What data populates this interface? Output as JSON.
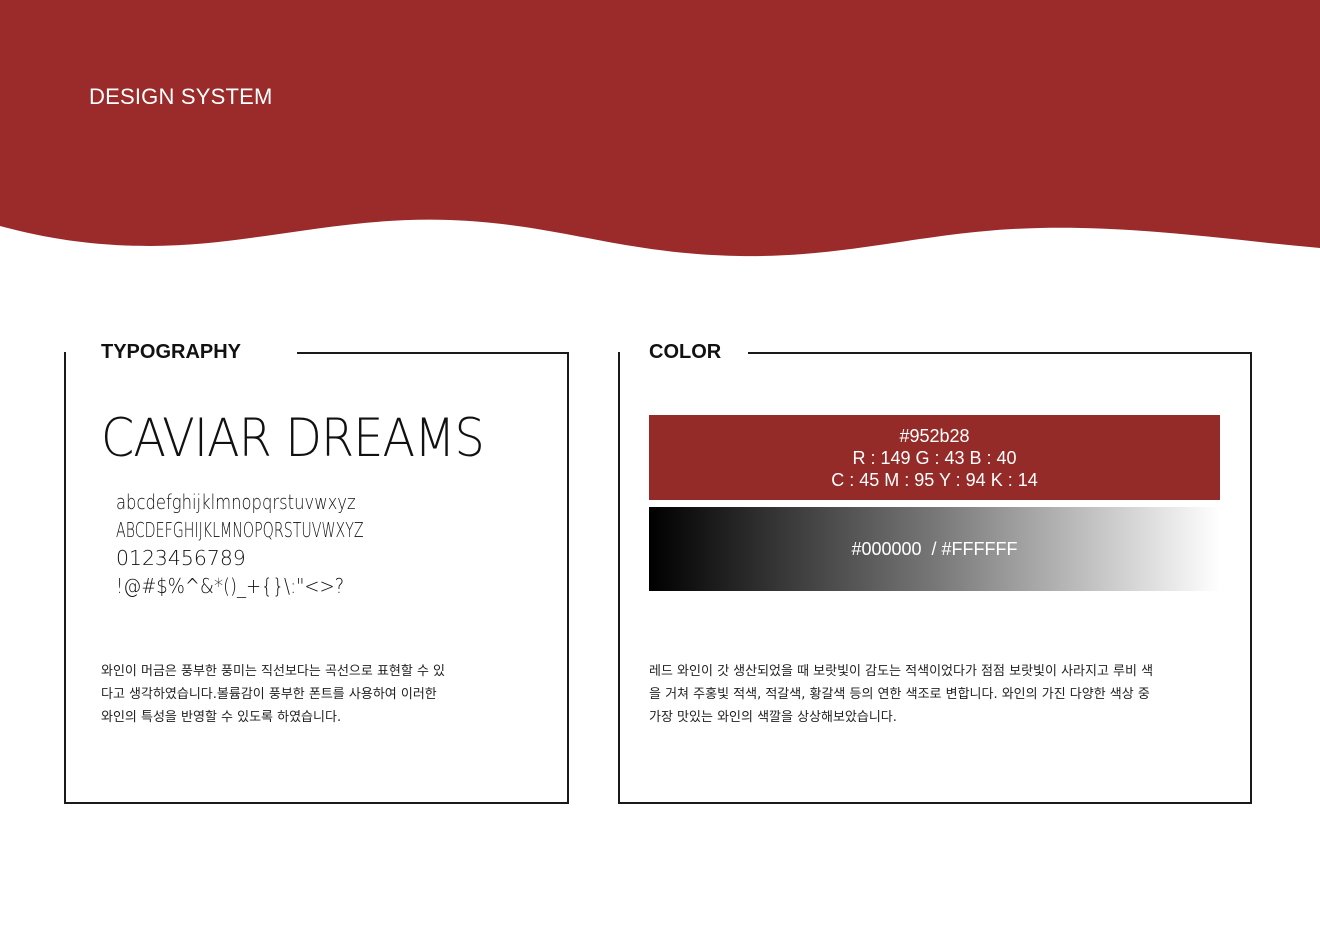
{
  "header": {
    "title": "DESIGN SYSTEM"
  },
  "colors": {
    "brand": "#9b2a2a",
    "swatch_red": "#952b28",
    "black": "#000000",
    "white": "#FFFFFF"
  },
  "typography": {
    "section_title": "TYPOGRAPHY",
    "font_name": "CAVIAR DREAMS",
    "specimen": {
      "lowercase": "abcdefghijklmnopqrstuvwxyz",
      "uppercase": "ABCDEFGHIJKLMNOPQRSTUVWXYZ",
      "digits": "0123456789",
      "symbols": "!@#$%^&*()_+{}\\:\"<>?"
    },
    "description_lines": [
      "와인이 머금은 풍부한 풍미는 직선보다는 곡선으로 표현할 수 있",
      "다고 생각하였습니다.볼륨감이 풍부한 폰트를 사용하여 이러한",
      "와인의 특성을 반영할 수 있도록 하였습니다."
    ]
  },
  "color": {
    "section_title": "COLOR",
    "primary_swatch": {
      "hex": "#952b28",
      "rgb": "R : 149 G : 43 B : 40",
      "cmyk": "C : 45 M : 95 Y : 94 K : 14"
    },
    "gradient_swatch": {
      "label": "#000000  / #FFFFFF"
    },
    "description_lines": [
      "레드 와인이 갓 생산되었을 때 보랏빛이 감도는 적색이었다가 점점 보랏빛이 사라지고 루비 색",
      "을 거쳐 주홍빛 적색, 적갈색, 황갈색 등의 연한 색조로 변합니다. 와인의 가진 다양한 색상 중",
      "가장 맛있는 와인의 색깔을 상상해보았습니다."
    ]
  }
}
